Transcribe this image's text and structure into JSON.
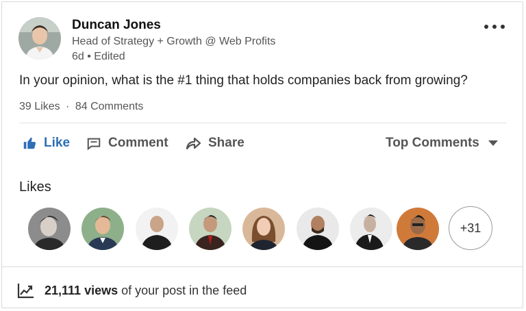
{
  "author": {
    "name": "Duncan Jones",
    "headline": "Head of Strategy + Growth @ Web Profits",
    "meta": "6d • Edited"
  },
  "post": {
    "text": "In your opinion, what is the #1 thing that holds companies back from growing?"
  },
  "counts": {
    "likes": "39 Likes",
    "separator": "·",
    "comments": "84 Comments"
  },
  "actions": {
    "like": "Like",
    "comment": "Comment",
    "share": "Share",
    "sort": "Top Comments"
  },
  "likes_section": {
    "heading": "Likes",
    "more_count": "+31"
  },
  "views": {
    "count": "21,111 views",
    "rest": " of your post in the feed"
  },
  "colors": {
    "accent": "#2d6fb7",
    "text_secondary": "#555555"
  },
  "icons": [
    "more-icon",
    "thumbs-up-icon",
    "comment-icon",
    "share-icon",
    "caret-down-icon",
    "analytics-icon"
  ]
}
